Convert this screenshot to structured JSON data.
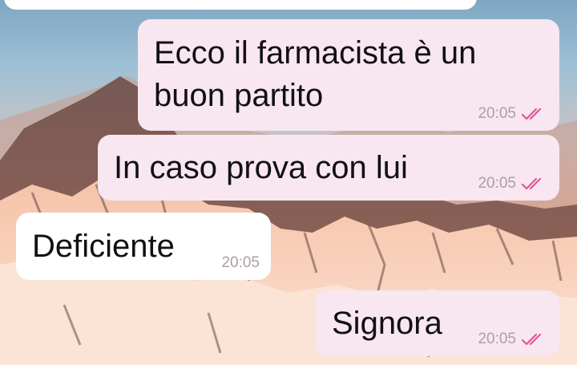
{
  "colors": {
    "outgoing_bubble": "#f8e6f0",
    "incoming_bubble": "#ffffff",
    "read_ticks": "#e0569a",
    "timestamp": "#a9a0a6"
  },
  "icons": {
    "read_receipt": "double-check-icon"
  },
  "messages": [
    {
      "direction": "outgoing",
      "text": "Ecco il farmacista è un\nbuon partito",
      "time": "20:05",
      "read": true
    },
    {
      "direction": "outgoing",
      "text": "In caso prova con lui",
      "time": "20:05",
      "read": true
    },
    {
      "direction": "incoming",
      "text": "Deficiente",
      "time": "20:05",
      "read": false
    },
    {
      "direction": "outgoing",
      "text": "Signora",
      "time": "20:05",
      "read": true
    }
  ]
}
